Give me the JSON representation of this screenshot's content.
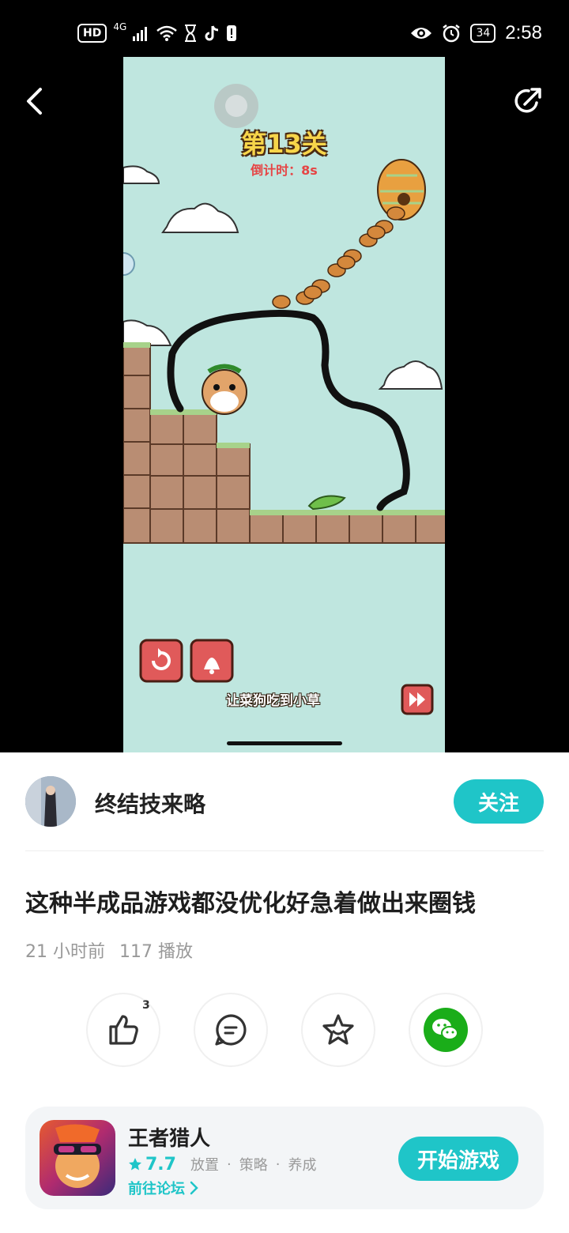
{
  "status_bar": {
    "hd_label": "HD",
    "network_label": "4G",
    "battery_level": "34",
    "time": "2:58"
  },
  "video": {
    "level_title": "第13关",
    "countdown": "倒计时：8s",
    "hint": "让菜狗吃到小草"
  },
  "author": {
    "name": "终结技来略",
    "follow_label": "关注"
  },
  "post": {
    "title": "这种半成品游戏都没优化好急着做出来圈钱",
    "time_ago": "21 小时前",
    "plays": "117 播放"
  },
  "actions": {
    "like_count": "3"
  },
  "game": {
    "name": "王者猎人",
    "rating": "7.7",
    "tags": [
      "放置",
      "策略",
      "养成"
    ],
    "tag_separator": "·",
    "forum_link": "前往论坛",
    "start_label": "开始游戏"
  },
  "colors": {
    "accent": "#1fc5c8",
    "wechat": "#1aad19"
  }
}
